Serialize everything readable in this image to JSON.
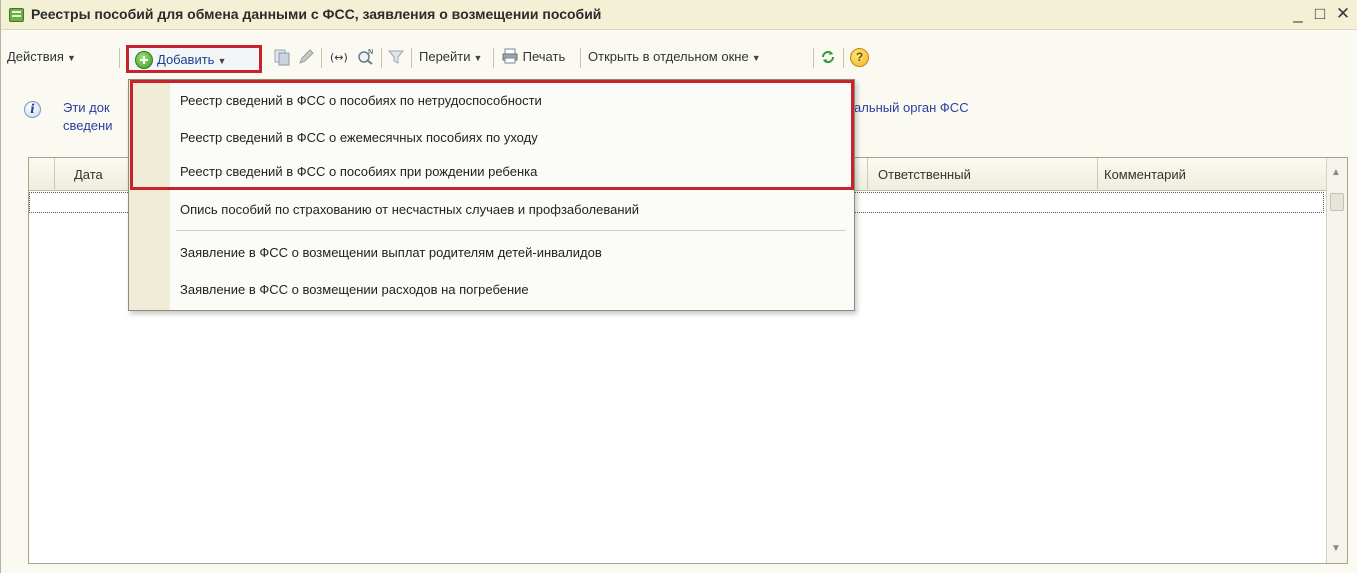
{
  "window": {
    "title": "Реестры пособий для обмена данными с ФСС, заявления о возмещении пособий",
    "controls": {
      "minimize": "_",
      "maximize": "□",
      "close": "✕"
    }
  },
  "toolbar": {
    "actions_label": "Действия",
    "add_label": "Добавить",
    "goto_label": "Перейти",
    "print_label": "Печать",
    "open_window_label": "Открыть в отдельном окне",
    "help_label": "?"
  },
  "info": {
    "line1_start": "Эти док",
    "line1_end": "альный орган ФСС",
    "line2_start": "сведени"
  },
  "table": {
    "columns": [
      "Дата",
      "Ответственный",
      "Комментарий"
    ],
    "rows": []
  },
  "add_menu": {
    "items": [
      "Реестр сведений в ФСС о пособиях по нетрудоспособности",
      "Реестр сведений в ФСС о ежемесячных пособиях по уходу",
      "Реестр сведений в ФСС о пособиях при рождении ребенка",
      "Опись пособий по страхованию от несчастных случаев и профзаболеваний",
      "Заявление в ФСС о возмещении выплат родителям детей-инвалидов",
      "Заявление в ФСС о возмещении расходов на погребение"
    ]
  },
  "icons": {
    "add": "plus-circle-icon",
    "copy": "copy-icon",
    "edit": "pencil-icon",
    "hierarchy": "hierarchy-arrows-icon",
    "find": "find-icon",
    "filter": "filter-icon",
    "print": "printer-icon",
    "refresh": "refresh-icon",
    "help": "help-icon",
    "info": "info-icon"
  },
  "colors": {
    "highlight": "#c8232c",
    "title_bar": "#f3f0d6",
    "link_text": "#2b3ea1",
    "add_text": "#1b3f8f"
  }
}
